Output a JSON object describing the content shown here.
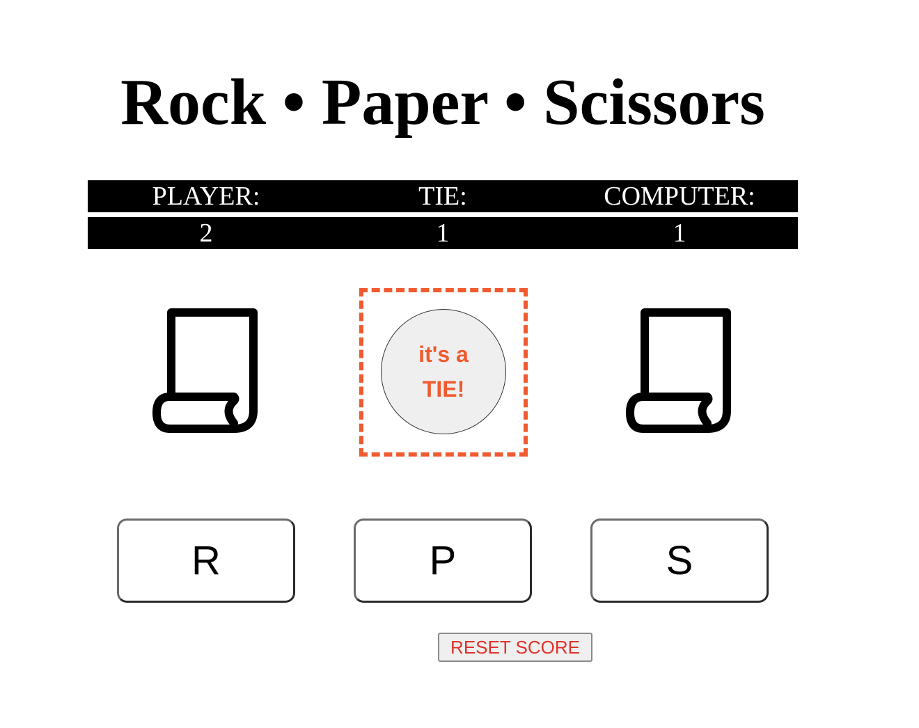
{
  "header": {
    "title": "Rock • Paper • Scissors"
  },
  "scoreboard": {
    "labels": {
      "player": "PLAYER:",
      "tie": "TIE:",
      "computer": "COMPUTER:"
    },
    "values": {
      "player": "2",
      "tie": "1",
      "computer": "1"
    }
  },
  "round": {
    "player_choice_icon": "paper-scroll-icon",
    "computer_choice_icon": "paper-scroll-icon",
    "result_line1": "it's a",
    "result_line2": "TIE!"
  },
  "controls": {
    "rock_label": "R",
    "paper_label": "P",
    "scissors_label": "S",
    "reset_label": "RESET SCORE"
  },
  "colors": {
    "accent": "#ef5a2f",
    "reset_text": "#e0312a",
    "scoreboard_bg": "#000000"
  }
}
